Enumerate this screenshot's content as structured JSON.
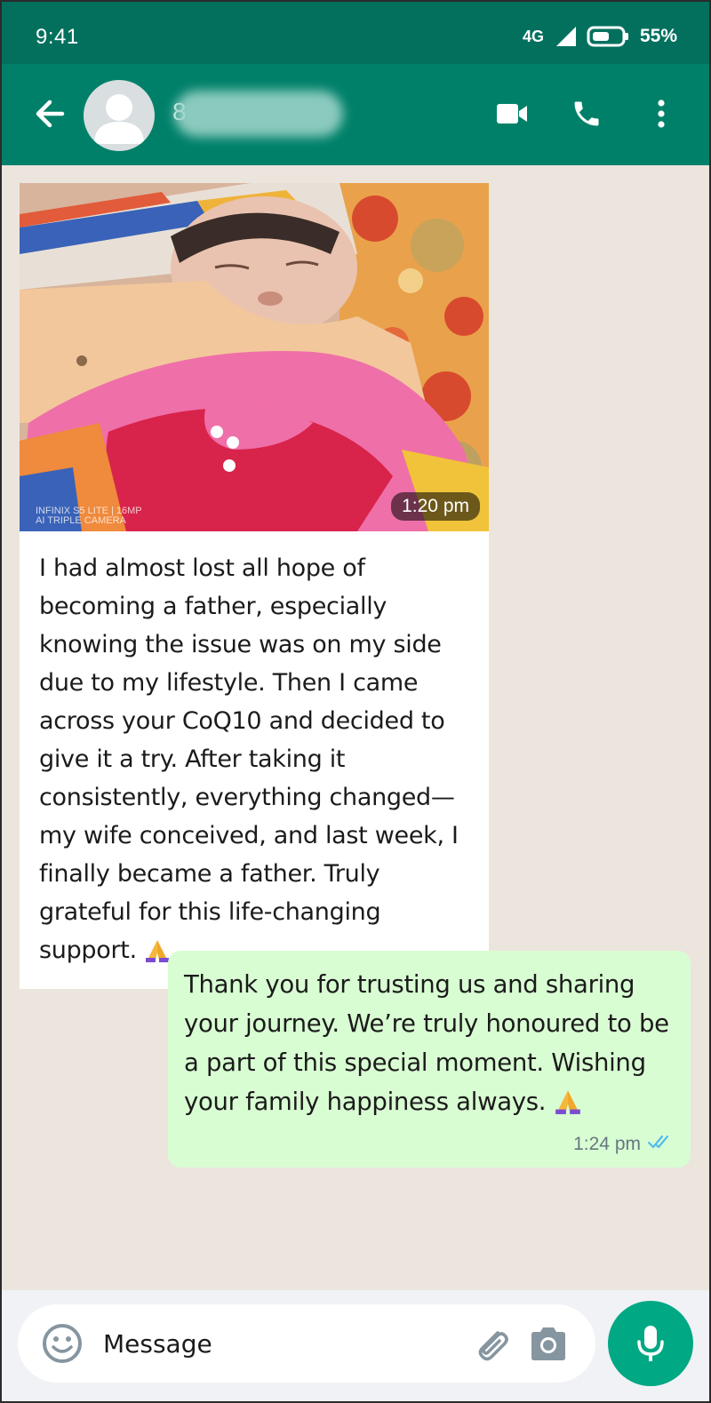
{
  "status_bar": {
    "time": "9:41",
    "network": "4G",
    "battery": "55%"
  },
  "header": {
    "contact_name_visible": "8",
    "icons": [
      "back-arrow-icon",
      "avatar-icon",
      "video-call-icon",
      "phone-icon",
      "more-vert-icon"
    ],
    "colors": {
      "status_bar": "#03705E",
      "header": "#008069"
    }
  },
  "messages": {
    "incoming": {
      "photo_time": "1:20 pm",
      "photo_watermark_line1": "INFINIX S5 LITE | 16MP",
      "photo_watermark_line2": "AI TRIPLE CAMERA",
      "text": "I had almost lost all hope of becoming a father, especially knowing the issue was on my side due to my lifestyle. Then I came across your CoQ10 and decided to give it a try. After taking it consistently, everything changed—my wife conceived, and last week, I finally became a father. Truly grateful for this life-changing support.",
      "emoji": "folded-hands"
    },
    "outgoing": {
      "text": "Thank you for trusting us and sharing your journey. We’re truly honoured to be a part of this special moment. Wishing your family happiness always.",
      "emoji": "folded-hands",
      "time": "1:24 pm",
      "status": "read",
      "bubble_color": "#D9FDD3"
    }
  },
  "composer": {
    "placeholder": "Message",
    "accent_color": "#00A884"
  }
}
